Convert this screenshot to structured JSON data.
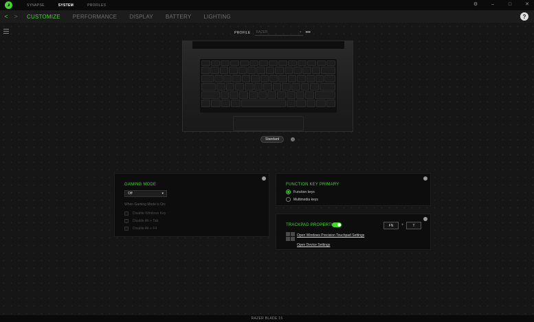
{
  "titlebar": {
    "tabs": [
      {
        "label": "SYNAPSE",
        "active": false
      },
      {
        "label": "SYSTEM",
        "active": true
      },
      {
        "label": "PROFILES",
        "active": false
      }
    ],
    "controls": {
      "settings": "⚙",
      "minimize": "–",
      "maximize": "□",
      "close": "✕"
    }
  },
  "navbar": {
    "back": "<",
    "forward": ">",
    "tabs": [
      {
        "label": "CUSTOMIZE",
        "active": true
      },
      {
        "label": "PERFORMANCE",
        "active": false
      },
      {
        "label": "DISPLAY",
        "active": false
      },
      {
        "label": "BATTERY",
        "active": false
      },
      {
        "label": "LIGHTING",
        "active": false
      }
    ],
    "help": "?"
  },
  "profile": {
    "label": "PROFILE",
    "value": "RAZER",
    "more": "•••"
  },
  "preset": {
    "label": "Standard",
    "info": "?"
  },
  "gaming_mode": {
    "title": "GAMING MODE",
    "selected": "Off",
    "when_label": "When Gaming Mode is On:",
    "options": [
      "Disable Windows Key",
      "Disable Alt + Tab",
      "Disable Alt + F4"
    ]
  },
  "function_key": {
    "title": "FUNCTION KEY PRIMARY",
    "options": [
      {
        "label": "Function keys",
        "selected": true
      },
      {
        "label": "Multimedia keys",
        "selected": false
      }
    ]
  },
  "trackpad": {
    "title": "TRACKPAD PROPERTIES",
    "enabled": true,
    "shortcut_key1": "FN",
    "shortcut_plus": "+",
    "shortcut_key2": "T",
    "link1": "Open Windows Precision Touchpad Settings",
    "link2": "Open Device Settings"
  },
  "status": {
    "device": "RAZER BLADE 15"
  },
  "colors": {
    "accent": "#44d62c",
    "background": "#161616",
    "panel": "#0d0d0d"
  }
}
